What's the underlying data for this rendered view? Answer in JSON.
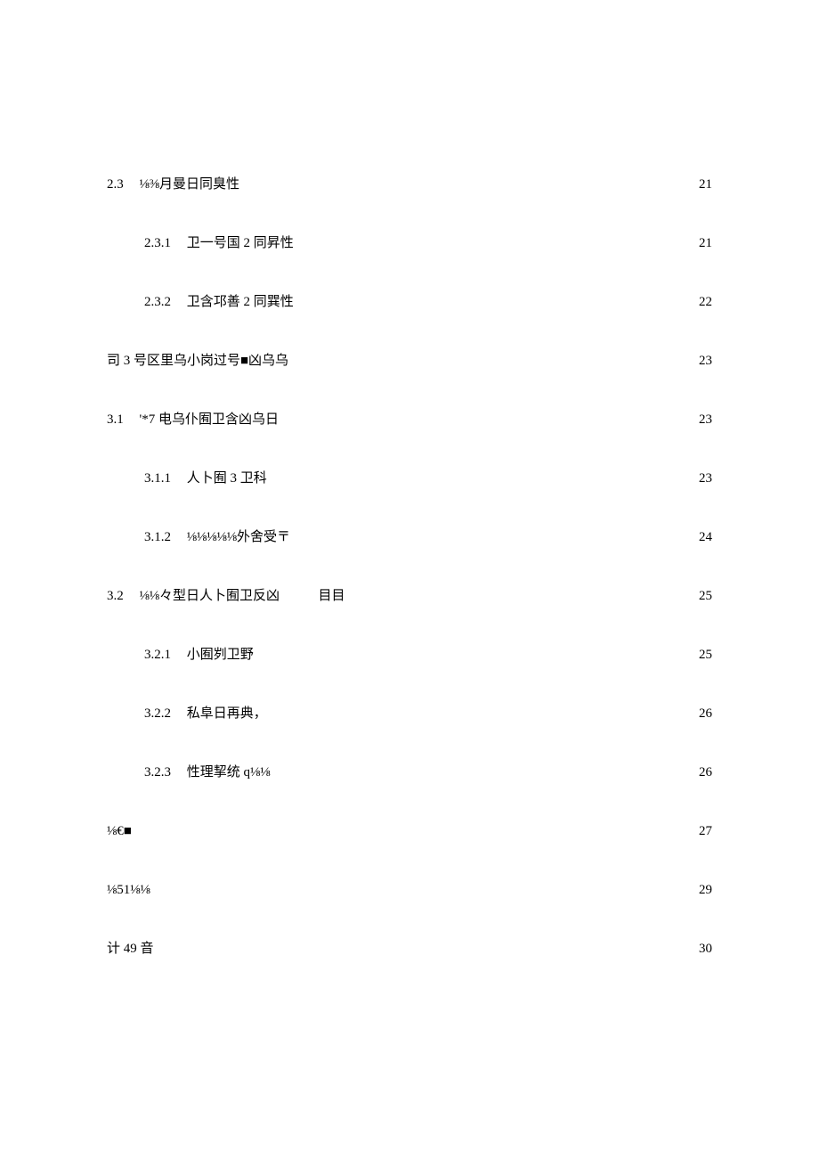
{
  "toc": [
    {
      "level": 0,
      "num": "2.3",
      "title": "⅛⅜月曼日同臭性",
      "page": "21",
      "dots": "loose"
    },
    {
      "level": 1,
      "num": "2.3.1",
      "title": "卫一号国 2 同昇性",
      "page": "21",
      "dots": "loose"
    },
    {
      "level": 1,
      "num": "2.3.2",
      "title": "卫含邛善 2 同巽性",
      "page": "22",
      "dots": "loose"
    },
    {
      "level": 0,
      "num": "",
      "title": "司 3 号区里乌小岗过号■凶乌乌",
      "page": "23",
      "dots": "loose"
    },
    {
      "level": 0,
      "num": "3.1",
      "title": "'*7 电乌仆囿卫含凶乌日",
      "page": "23",
      "dots": "loose"
    },
    {
      "level": 1,
      "num": "3.1.1",
      "title": "人卜囿 3 卫科",
      "page": "23",
      "dots": "loose"
    },
    {
      "level": 1,
      "num": "3.1.2",
      "title": "⅛⅛⅛⅛⅛外舍受〒",
      "page": "24",
      "dots": "loose"
    },
    {
      "level": 0,
      "num": "3.2",
      "title": "⅛⅛々型日人卜囿卫反凶",
      "title_tail": "目目",
      "page": "25",
      "dots": "loose"
    },
    {
      "level": 1,
      "num": "3.2.1",
      "title": "小囿刿卫野",
      "page": "25",
      "dots": "loose"
    },
    {
      "level": 1,
      "num": "3.2.2",
      "title": "私阜日再典，",
      "page": "26",
      "dots": "loose"
    },
    {
      "level": 1,
      "num": "3.2.3",
      "title": "性理挈统 q⅛⅛",
      "page": "26",
      "dots": "tight"
    },
    {
      "level": 0,
      "num": "",
      "title": "⅛€■",
      "page": "27",
      "dots": "tight"
    },
    {
      "level": 0,
      "num": "",
      "title": "⅛51⅛⅛",
      "page": "29",
      "dots": "tight"
    },
    {
      "level": 0,
      "num": "",
      "title": "计 49 音",
      "page": "30",
      "dots": "loose"
    }
  ]
}
